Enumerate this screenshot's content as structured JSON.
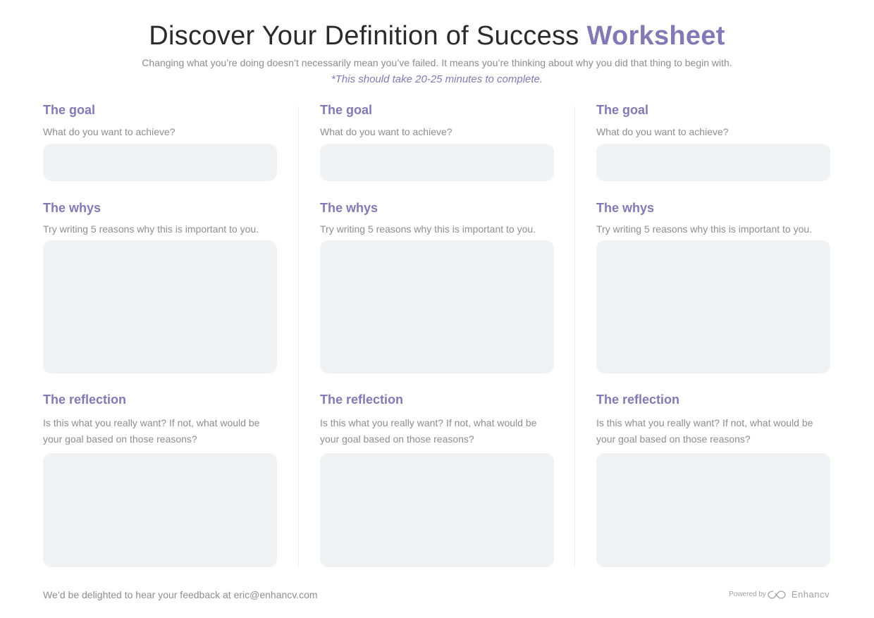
{
  "header": {
    "title_main": "Discover Your Definition of Success",
    "title_accent": "Worksheet",
    "subtitle": "Changing what you’re doing doesn’t necessarily mean you’ve failed. It means you’re thinking about why you did that thing to begin with.",
    "note": "*This should take 20-25 minutes to complete."
  },
  "columns": [
    {
      "goal_heading": "The goal",
      "goal_prompt": "What do you want to achieve?",
      "goal_value": "",
      "whys_heading": "The whys",
      "whys_prompt": "Try writing 5 reasons why this is important to you.",
      "whys_value": "",
      "reflection_heading": "The reflection",
      "reflection_prompt": "Is this what you really want? If not, what would be your goal based on those reasons?",
      "reflection_value": ""
    },
    {
      "goal_heading": "The goal",
      "goal_prompt": "What do you want to achieve?",
      "goal_value": "",
      "whys_heading": "The whys",
      "whys_prompt": "Try writing 5 reasons why this is important to you.",
      "whys_value": "",
      "reflection_heading": "The reflection",
      "reflection_prompt": "Is this what you really want? If not, what would be your goal based on those reasons?",
      "reflection_value": ""
    },
    {
      "goal_heading": "The goal",
      "goal_prompt": "What do you want to achieve?",
      "goal_value": "",
      "whys_heading": "The whys",
      "whys_prompt": "Try writing 5 reasons why this is important to you.",
      "whys_value": "",
      "reflection_heading": "The reflection",
      "reflection_prompt": "Is this what you really want? If not, what would be your goal based on those reasons?",
      "reflection_value": ""
    }
  ],
  "footer": {
    "feedback": "We’d be delighted to hear your feedback at eric@enhancv.com",
    "powered_by": "Powered by",
    "brand": "Enhancv"
  },
  "colors": {
    "accent": "#8479b5",
    "box": "#eff3f6",
    "text_muted": "#8d8d93",
    "title": "#2b2b2b"
  }
}
